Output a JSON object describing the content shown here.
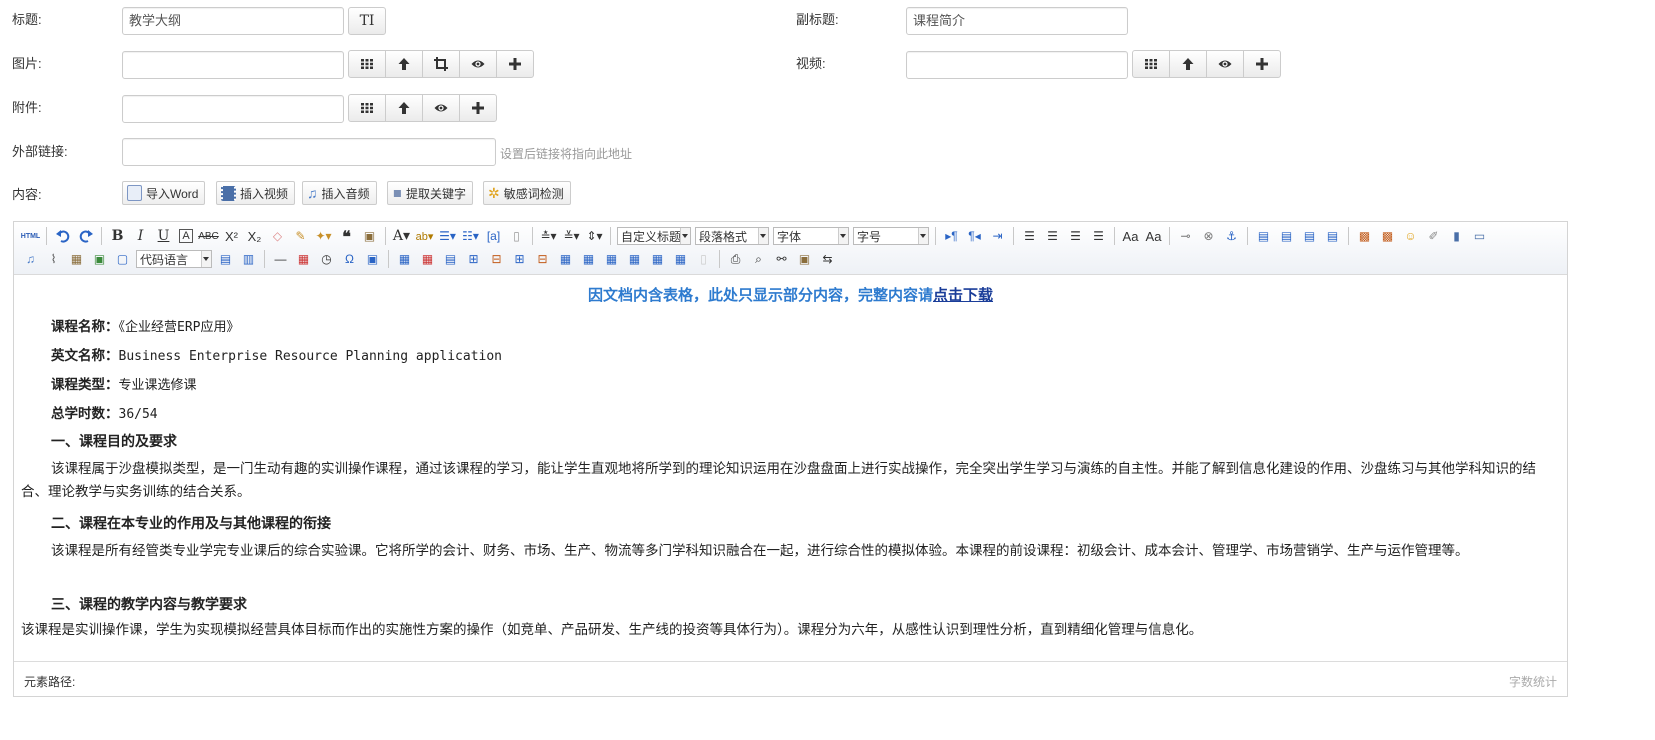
{
  "form": {
    "title_label": "标题:",
    "title_value": "教学大纲",
    "title_btn": "TI",
    "subtitle_label": "副标题:",
    "subtitle_value": "课程简介",
    "image_label": "图片:",
    "video_label": "视频:",
    "attachment_label": "附件:",
    "link_label": "外部链接:",
    "link_hint": "设置后链接将指向此地址",
    "content_label": "内容:"
  },
  "content_buttons": {
    "import_word": "导入Word",
    "insert_video": "插入视频",
    "insert_audio": "插入音频",
    "extract_keywords": "提取关键字",
    "sensitive_check": "敏感词检测"
  },
  "toolbar": {
    "html": "HTML",
    "custom_title": "自定义标题",
    "paragraph_format": "段落格式",
    "font": "字体",
    "font_size": "字号",
    "code_language": "代码语言"
  },
  "doc": {
    "notice": "因文档内含表格，此处只显示部分内容，完整内容请",
    "notice_link": "点击下载",
    "course_name_label": "课程名称：",
    "course_name": "《企业经营ERP应用》",
    "english_name_label": "英文名称：",
    "english_name": "Business Enterprise Resource Planning application",
    "course_type_label": "课程类型：",
    "course_type": "专业课选修课",
    "total_hours_label": "总学时数：",
    "total_hours": "36/54",
    "section1_title": "一、课程目的及要求",
    "section1_text": "该课程属于沙盘模拟类型，是一门生动有趣的实训操作课程，通过该课程的学习，能让学生直观地将所学到的理论知识运用在沙盘盘面上进行实战操作，完全突出学生学习与演练的自主性。并能了解到信息化建设的作用、沙盘练习与其他学科知识的结合、理论教学与实务训练的结合关系。",
    "section2_title": "二、课程在本专业的作用及与其他课程的衔接",
    "section2_text": "该课程是所有经管类专业学完专业课后的综合实验课。它将所学的会计、财务、市场、生产、物流等多门学科知识融合在一起，进行综合性的模拟体验。本课程的前设课程：初级会计、成本会计、管理学、市场营销学、生产与运作管理等。",
    "section3_title": "三、课程的教学内容与教学要求",
    "section3_text": "该课程是实训操作课，学生为实现模拟经营具体目标而作出的实施性方案的操作（如竞单、产品研发、生产线的投资等具体行为）。课程分为六年，从感性认识到理性分析，直到精细化管理与信息化。"
  },
  "status": {
    "element_path": "元素路径:",
    "word_count": "字数统计"
  }
}
